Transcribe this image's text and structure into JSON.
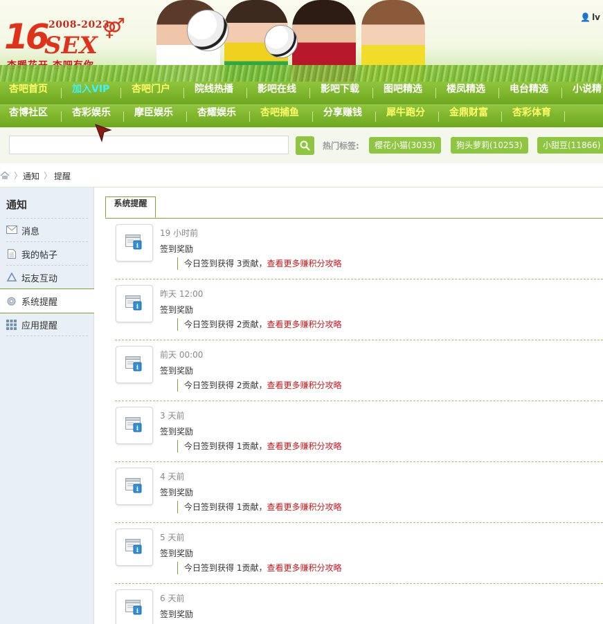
{
  "header": {
    "logo_years": "2008-2023",
    "logo_number": "16",
    "logo_word": "SEX",
    "logo_slogan": "杏暖花开 杏吧有你",
    "user_initial": "lv"
  },
  "nav_row1": [
    {
      "label": "杏吧首页",
      "color": "#ffff66"
    },
    {
      "label": "加入VIP",
      "color": "#3df2ff"
    },
    {
      "label": "杏吧门户",
      "color": "#ffff66"
    },
    {
      "label": "院线热播",
      "color": "#ffffff"
    },
    {
      "label": "影吧在线",
      "color": "#ffffff"
    },
    {
      "label": "影吧下载",
      "color": "#ffffff"
    },
    {
      "label": "图吧精选",
      "color": "#ffffff"
    },
    {
      "label": "楼凤精选",
      "color": "#ffffff"
    },
    {
      "label": "电台精选",
      "color": "#ffffff"
    },
    {
      "label": "小说精",
      "color": "#ffffff"
    }
  ],
  "nav_row2": [
    {
      "label": "杏博社区",
      "color": "#ffffff"
    },
    {
      "label": "杏彩娱乐",
      "color": "#ffffff"
    },
    {
      "label": "摩臣娱乐",
      "color": "#ffffff"
    },
    {
      "label": "杏耀娱乐",
      "color": "#ffffff"
    },
    {
      "label": "杏吧捕鱼",
      "color": "#ffff66"
    },
    {
      "label": "分享赚钱",
      "color": "#ffffff"
    },
    {
      "label": "犀牛跑分",
      "color": "#ffff66"
    },
    {
      "label": "金鼎财富",
      "color": "#ffff66"
    },
    {
      "label": "杏彩体育",
      "color": "#ffff66"
    }
  ],
  "search": {
    "value": "",
    "hot_label": "热门标签:",
    "tags": [
      "樱花小猫(3033)",
      "狗头萝莉(10253)",
      "小甜豆(11866)"
    ]
  },
  "breadcrumb": [
    "通知",
    "提醒"
  ],
  "sidebar": {
    "title": "通知",
    "items": [
      {
        "label": "消息",
        "icon": "envelope-icon",
        "active": false
      },
      {
        "label": "我的帖子",
        "icon": "document-icon",
        "active": false
      },
      {
        "label": "坛友互动",
        "icon": "recycle-icon",
        "active": false
      },
      {
        "label": "系统提醒",
        "icon": "gear-icon",
        "active": true
      },
      {
        "label": "应用提醒",
        "icon": "grid-icon",
        "active": false
      }
    ]
  },
  "main": {
    "tab_label": "系统提醒",
    "notices": [
      {
        "time": "19 小时前",
        "title": "签到奖励",
        "text": "今日签到获得 3贡献，",
        "link": "查看更多赚积分攻略"
      },
      {
        "time": "昨天 12:00",
        "title": "签到奖励",
        "text": "今日签到获得 2贡献，",
        "link": "查看更多赚积分攻略"
      },
      {
        "time": "前天 00:00",
        "title": "签到奖励",
        "text": "今日签到获得 2贡献，",
        "link": "查看更多赚积分攻略"
      },
      {
        "time": "3 天前",
        "title": "签到奖励",
        "text": "今日签到获得 1贡献，",
        "link": "查看更多赚积分攻略"
      },
      {
        "time": "4 天前",
        "title": "签到奖励",
        "text": "今日签到获得 1贡献，",
        "link": "查看更多赚积分攻略"
      },
      {
        "time": "5 天前",
        "title": "签到奖励",
        "text": "今日签到获得 1贡献，",
        "link": "查看更多赚积分攻略"
      },
      {
        "time": "6 天前",
        "title": "签到奖励",
        "text": "",
        "link": ""
      }
    ]
  },
  "colors": {
    "nav_green": "#7ab62c",
    "accent_red": "#c8151b",
    "tag_green": "#8ec541"
  }
}
